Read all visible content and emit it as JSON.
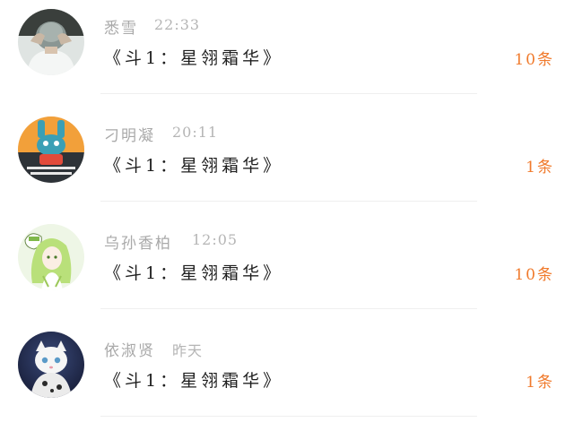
{
  "messages": [
    {
      "name": "悉雪",
      "time": "22:33",
      "title": "《斗1：星翎霜华》",
      "count": "10条",
      "avatar_icon": "avatar-back-view-person"
    },
    {
      "name": "刁明凝",
      "time": "20:11",
      "title": "《斗1：星翎霜华》",
      "count": "1条",
      "avatar_icon": "avatar-cartoon-rabbit"
    },
    {
      "name": "乌孙香柏",
      "time": "12:05",
      "title": "《斗1：星翎霜华》",
      "count": "10条",
      "avatar_icon": "avatar-green-hair-anime-girl"
    },
    {
      "name": "依淑贤",
      "time": "昨天",
      "title": "《斗1：星翎霜华》",
      "count": "1条",
      "avatar_icon": "avatar-white-cat"
    }
  ],
  "colors": {
    "accent": "#f07a2c",
    "name_gray": "#a9a9a9",
    "title_dark": "#1f1f1f"
  }
}
